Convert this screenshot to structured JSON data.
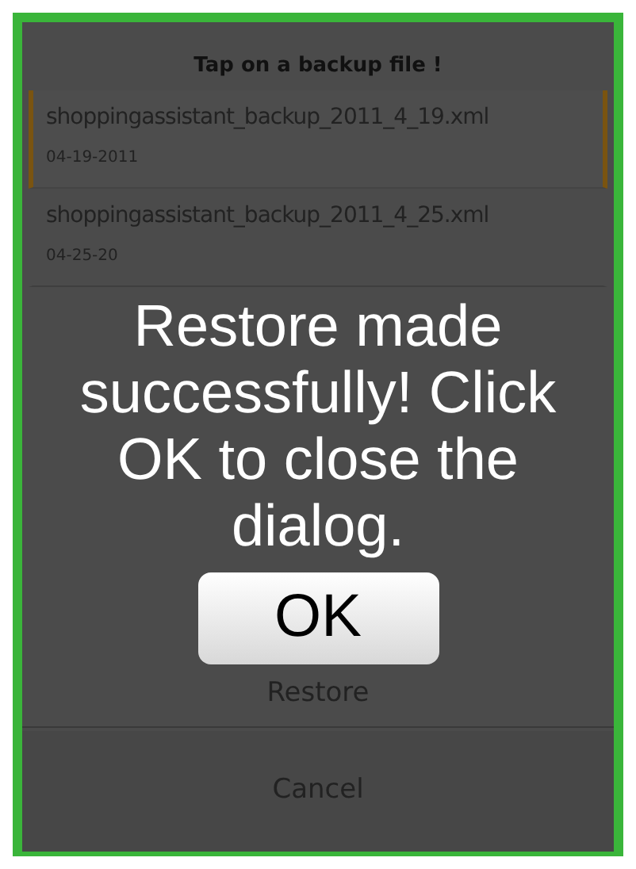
{
  "dialog": {
    "title": "Tap on a backup file !",
    "files": [
      {
        "name": "shoppingassistant_backup_2011_4_19.xml",
        "date": "04-19-2011",
        "selected": true
      },
      {
        "name": "shoppingassistant_backup_2011_4_25.xml",
        "date": "04-25-20",
        "selected": false
      }
    ],
    "buttons": [
      "Restore",
      "Cancel"
    ]
  },
  "message": {
    "text": "Restore made successfully! Click OK to close the dialog.",
    "button": "OK"
  }
}
